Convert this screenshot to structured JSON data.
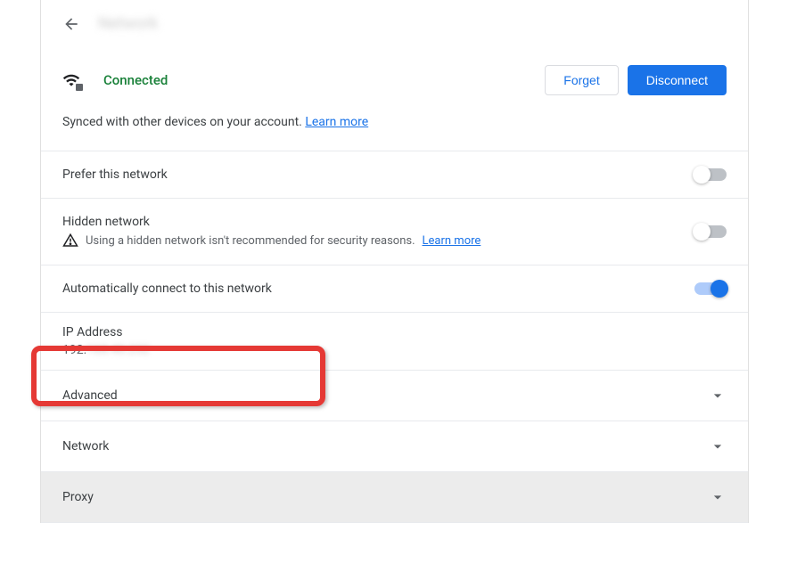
{
  "header": {
    "network_name": "Network"
  },
  "status": {
    "label": "Connected",
    "forget_button": "Forget",
    "disconnect_button": "Disconnect"
  },
  "sync": {
    "text": "Synced with other devices on your account. ",
    "learn_more": "Learn more"
  },
  "settings": {
    "prefer": {
      "label": "Prefer this network",
      "enabled": false
    },
    "hidden": {
      "label": "Hidden network",
      "warning": "Using a hidden network isn't recommended for security reasons.",
      "learn_more": "Learn more",
      "enabled": false
    },
    "auto_connect": {
      "label": "Automatically connect to this network",
      "enabled": true
    }
  },
  "ip": {
    "label": "IP Address",
    "value_visible": "192.",
    "value_hidden": "168.40.232"
  },
  "expandable": {
    "advanced": "Advanced",
    "network": "Network",
    "proxy": "Proxy"
  }
}
